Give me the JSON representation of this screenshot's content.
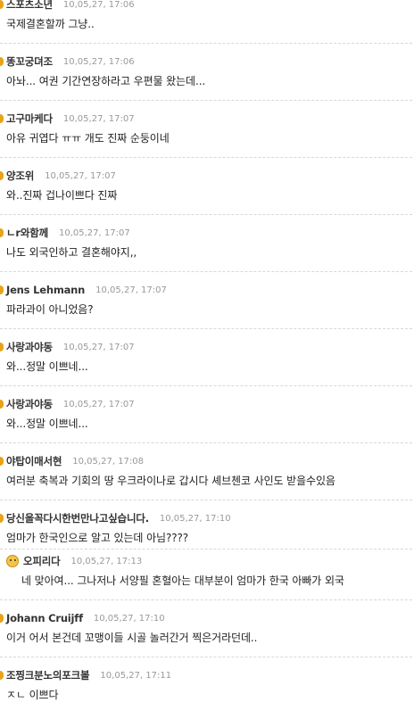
{
  "comments": [
    {
      "author": "스포츠소년",
      "time": "10,05,27, 17:06",
      "text": "국제결혼할까 그냥.."
    },
    {
      "author": "똥꼬궁뎌조",
      "time": "10,05,27, 17:06",
      "text": "아놔... 여권 기간연장하라고 우편물 왔는데..."
    },
    {
      "author": "고구마케다",
      "time": "10,05,27, 17:07",
      "text": "아유 귀엽다 ㅠㅠ 개도 진짜 순둥이네"
    },
    {
      "author": "양조위",
      "time": "10,05,27, 17:07",
      "text": "와..진짜 겁나이쁘다 진짜"
    },
    {
      "author": "ㄴr와함께",
      "time": "10,05,27, 17:07",
      "text": "나도 외국인하고 결혼해야지,,"
    },
    {
      "author": "Jens Lehmann",
      "time": "10,05,27, 17:07",
      "text": "파라과이 아니었음?"
    },
    {
      "author": "사랑과야동",
      "time": "10,05,27, 17:07",
      "text": "와...정말 이쁘네..."
    },
    {
      "author": "사랑과야동",
      "time": "10,05,27, 17:07",
      "text": "와...정말 이쁘네..."
    },
    {
      "author": "야탑이매서현",
      "time": "10,05,27, 17:08",
      "text": "여러분 축복과 기회의 땅 우크라이나로 갑시다 셰브첸코 사인도 받을수있음"
    },
    {
      "author": "당신을꼭다시한번만나고싶습니다.",
      "time": "10,05,27, 17:10",
      "text": "엄마가 한국인으로 알고 있는데 아님????"
    },
    {
      "author": "오피리다",
      "time": "10,05,27, 17:13",
      "text": "네 맞아여... 그나저나 서양필 혼혈아는 대부분이 엄마가 한국 아빠가 외국",
      "reply": true
    },
    {
      "author": "Johann Cruijff",
      "time": "10,05,27, 17:10",
      "text": "이거 어서 본건데 꼬맹이들 시골 놀러간거 찍은거라던데.."
    },
    {
      "author": "조찡크분노의포크볼",
      "time": "10,05,27, 17:11",
      "text": "ㅈㄴ 이쁘다"
    }
  ]
}
